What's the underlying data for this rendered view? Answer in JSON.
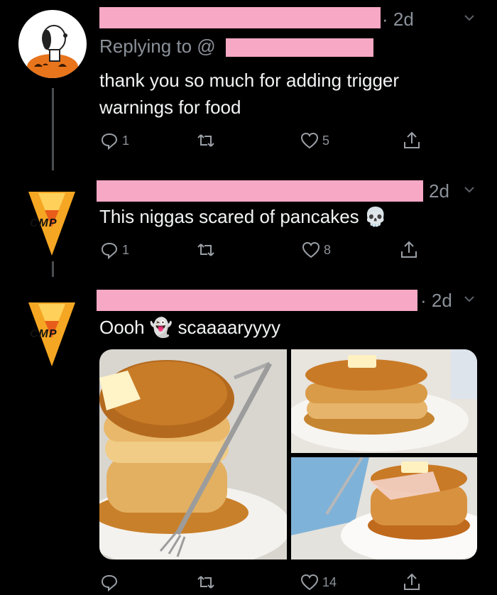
{
  "tweets": [
    {
      "time": "· 2d",
      "reply_prefix": "Replying to @",
      "text": "thank you so much for adding trigger warnings for food",
      "reply_count": "1",
      "like_count": "5"
    },
    {
      "time": "2d",
      "text": "This niggas scared of pancakes",
      "emoji": "💀",
      "reply_count": "1",
      "like_count": "8"
    },
    {
      "time": "· 2d",
      "text_before": "Oooh",
      "emoji": "👻",
      "text_after": "scaaaaryyyy",
      "like_count": "14"
    }
  ],
  "avatar_logo_text": "CMP",
  "colors": {
    "background": "#000000",
    "redaction": "#f7a8c4",
    "muted": "#8b9199",
    "text": "#f2f3f4"
  },
  "icons": [
    "reply-icon",
    "retweet-icon",
    "like-icon",
    "share-icon",
    "chevron-down-icon"
  ]
}
